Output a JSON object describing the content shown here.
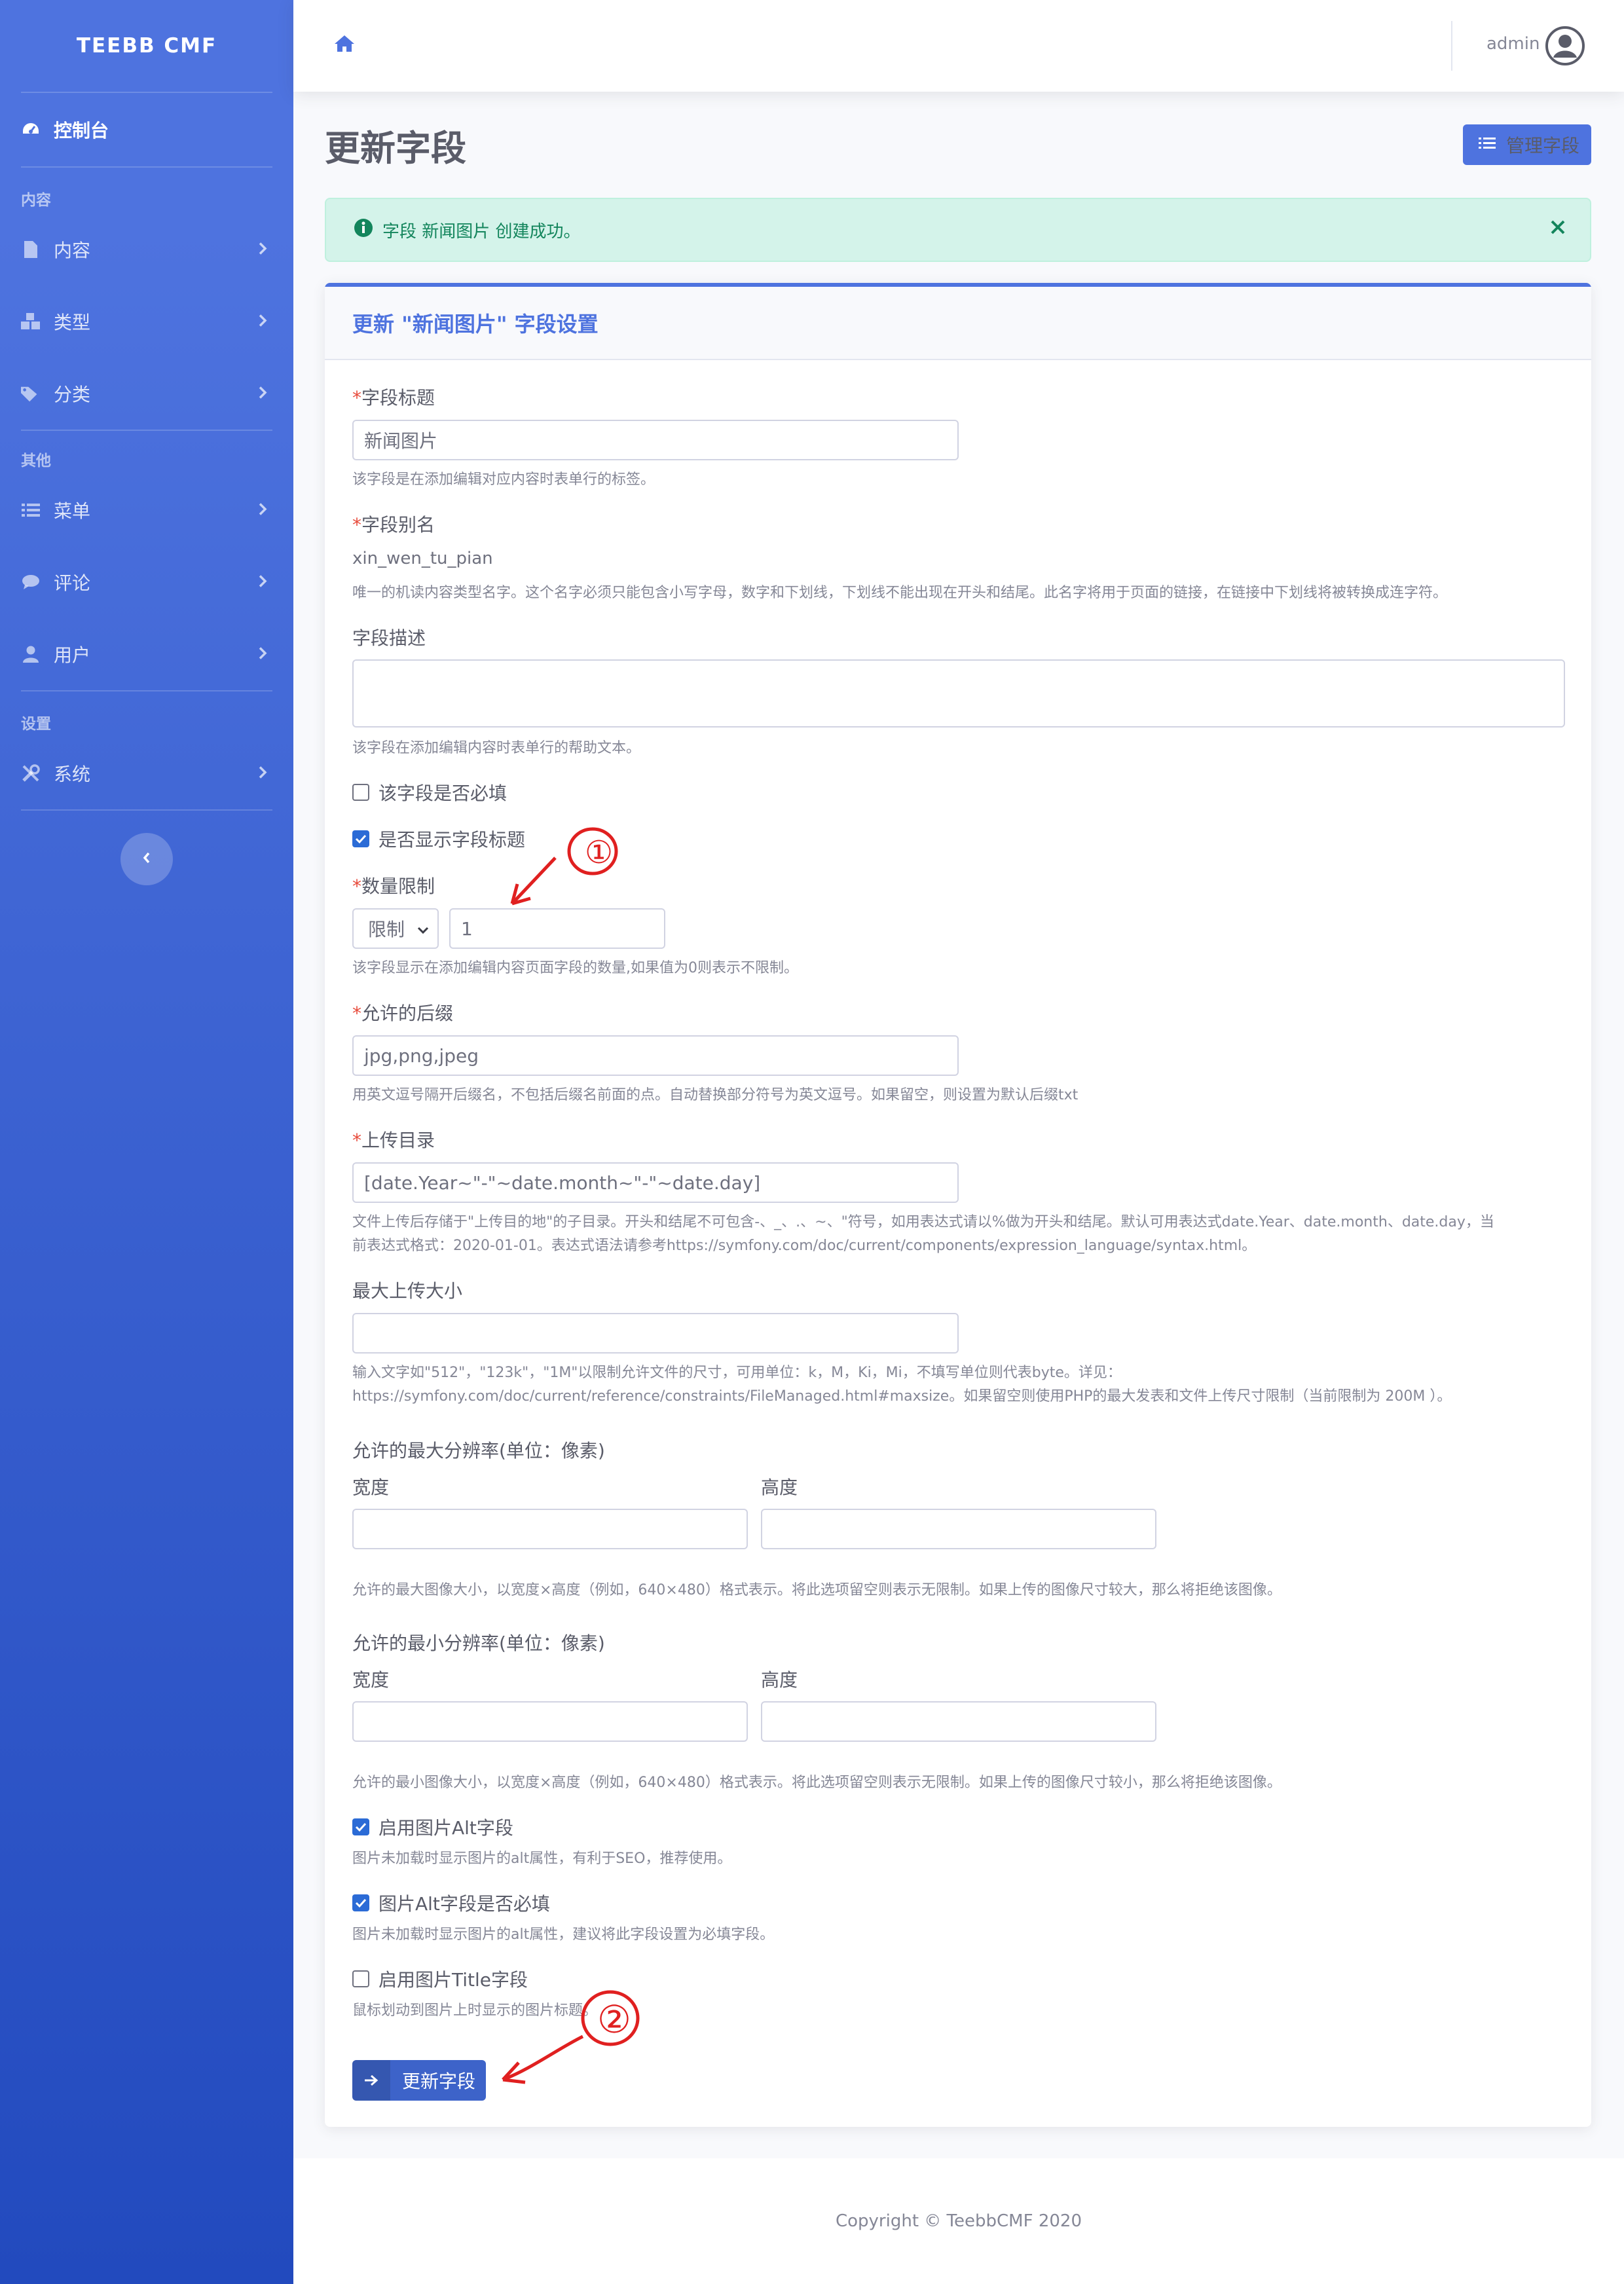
{
  "brand": "TEEBB CMF",
  "sidebar": {
    "dashboard": "控制台",
    "sections": [
      {
        "heading": "内容",
        "items": [
          "内容",
          "类型",
          "分类"
        ]
      },
      {
        "heading": "其他",
        "items": [
          "菜单",
          "评论",
          "用户"
        ]
      },
      {
        "heading": "设置",
        "items": [
          "系统"
        ]
      }
    ],
    "icons": [
      "tachometer-icon",
      "file-icon",
      "cubes-icon",
      "tags-icon",
      "list-icon",
      "comment-icon",
      "user-icon",
      "tools-icon"
    ]
  },
  "topbar": {
    "user": "admin",
    "home_icon": "home-icon"
  },
  "page": {
    "title": "更新字段",
    "manage_button": "管理字段"
  },
  "alert": {
    "text": "字段 新闻图片 创建成功。"
  },
  "card": {
    "title": "更新 \"新闻图片\" 字段设置"
  },
  "form": {
    "label_field_title": "字段标题",
    "value_field_title": "新闻图片",
    "help_field_title": "该字段是在添加编辑对应内容时表单行的标签。",
    "label_alias": "字段别名",
    "value_alias": "xin_wen_tu_pian",
    "help_alias": "唯一的机读内容类型名字。这个名字必须只能包含小写字母，数字和下划线，下划线不能出现在开头和结尾。此名字将用于页面的链接，在链接中下划线将被转换成连字符。",
    "label_desc": "字段描述",
    "help_desc": "该字段在添加编辑内容时表单行的帮助文本。",
    "chk_required": "该字段是否必填",
    "chk_show_title": "是否显示字段标题",
    "label_limit": "数量限制",
    "limit_select": "限制",
    "limit_value": "1",
    "help_limit": "该字段显示在添加编辑内容页面字段的数量,如果值为0则表示不限制。",
    "label_suffix": "允许的后缀",
    "value_suffix": "jpg,png,jpeg",
    "help_suffix": "用英文逗号隔开后缀名，不包括后缀名前面的点。自动替换部分符号为英文逗号。如果留空，则设置为默认后缀txt",
    "label_dir": "上传目录",
    "value_dir": "[date.Year~\"-\"~date.month~\"-\"~date.day]",
    "help_dir_1": "文件上传后存储于\"上传目的地\"的子目录。开头和结尾不可包含-、_、.、~、\"符号，如用表达式请以%做为开头和结尾。默认可用表达式date.Year、date.month、date.day，当",
    "help_dir_2": "前表达式格式：2020-01-01。表达式语法请参考https://symfony.com/doc/current/components/expression_language/syntax.html。",
    "label_maxsize": "最大上传大小",
    "help_maxsize_1": "输入文字如\"512\"，\"123k\"，\"1M\"以限制允许文件的尺寸，可用单位：k，M，Ki，Mi，不填写单位则代表byte。详见：",
    "help_maxsize_2": "https://symfony.com/doc/current/reference/constraints/FileManaged.html#maxsize。如果留空则使用PHP的最大发表和文件上传尺寸限制（当前限制为 200M ）。",
    "label_maxres": "允许的最大分辨率(单位：像素)",
    "label_width": "宽度",
    "label_height": "高度",
    "help_maxres": "允许的最大图像大小，以宽度×高度（例如，640×480）格式表示。将此选项留空则表示无限制。如果上传的图像尺寸较大，那么将拒绝该图像。",
    "label_minres": "允许的最小分辨率(单位：像素)",
    "help_minres": "允许的最小图像大小，以宽度×高度（例如，640×480）格式表示。将此选项留空则表示无限制。如果上传的图像尺寸较小，那么将拒绝该图像。",
    "chk_alt": "启用图片Alt字段",
    "help_alt": "图片未加载时显示图片的alt属性，有利于SEO，推荐使用。",
    "chk_alt_required": "图片Alt字段是否必填",
    "help_alt_required": "图片未加载时显示图片的alt属性，建议将此字段设置为必填字段。",
    "chk_title": "启用图片Title字段",
    "help_title": "鼠标划动到图片上时显示的图片标题。",
    "submit": "更新字段",
    "checked": {
      "required": false,
      "show_title": true,
      "alt": true,
      "alt_required": true,
      "title": false
    }
  },
  "annotations": [
    "①",
    "②"
  ],
  "footer": "Copyright © TeebbCMF 2020",
  "colors": {
    "primary": "#4e73df",
    "sidebar_bottom": "#224abe",
    "success_bg": "#d4f3ea",
    "success_text": "#13855c",
    "annotation": "#e02020"
  }
}
